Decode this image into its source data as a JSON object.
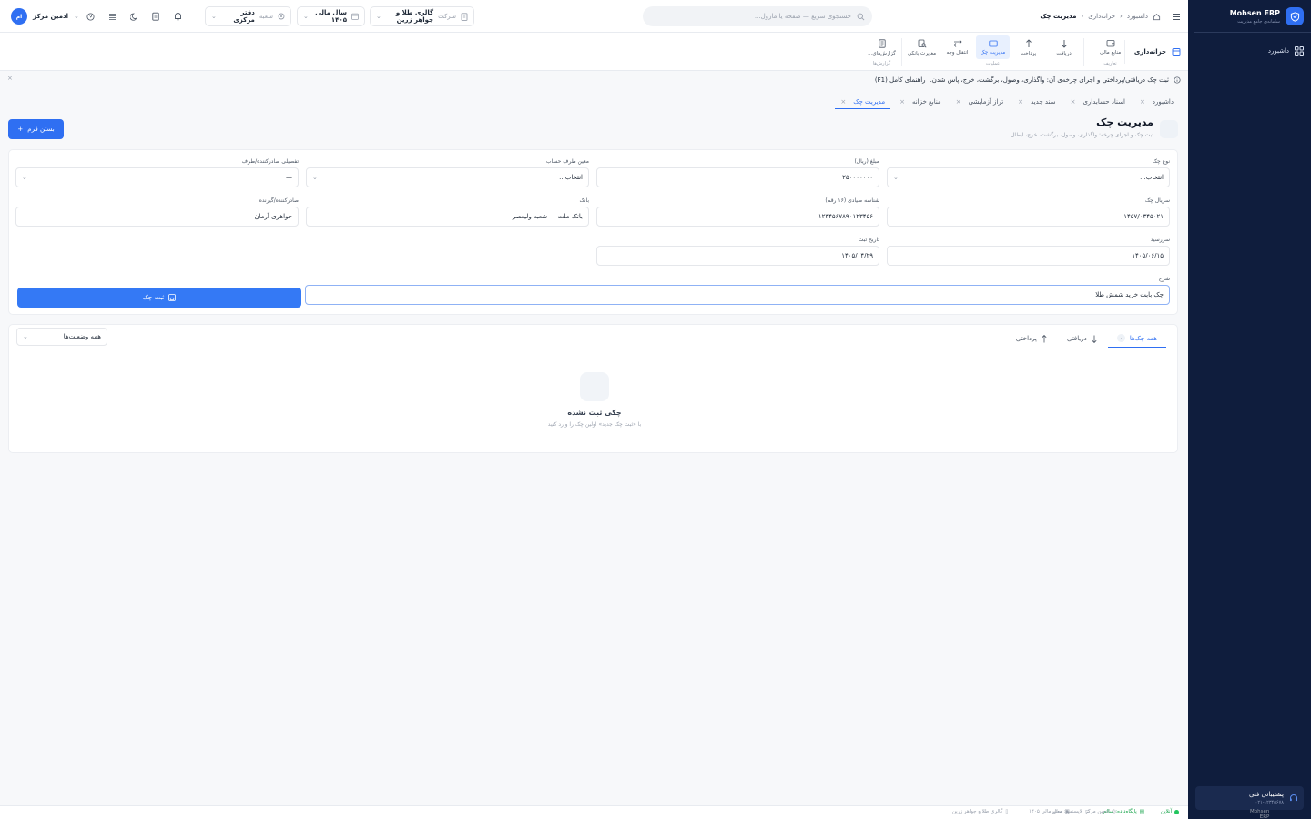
{
  "sidebar": {
    "brand_name": "Mohsen ERP",
    "brand_sub": "سامانه‌ی جامع مدیریت",
    "nav": [
      {
        "label": "داشبورد",
        "icon": "grid-icon"
      }
    ],
    "support_title": "پشتیبانی فنی",
    "support_phone": "۰۲۱-۱۲۳۴۵۶۷۸",
    "colors": {
      "bg": "#0f1d3d",
      "accent": "#2f6ff2"
    }
  },
  "header": {
    "breadcrumb": [
      "داشبورد",
      "خزانه‌داری",
      "مدیریت چک"
    ],
    "search_placeholder": "جستجوی سریع — صفحه یا ماژول...",
    "company_label": "شرکت",
    "company_value": "گالری طلا و جواهر زرین",
    "fiscal_year": "سال مالی ۱۴۰۵",
    "branch_label": "شعبه",
    "branch_value": "دفتر مرکزی",
    "user_name": "ادمین مرکز",
    "user_initials": "ام"
  },
  "ribbon": {
    "module": "خزانه‌داری",
    "groups": [
      {
        "label": "تعاریف",
        "items": [
          {
            "label": "منابع مالی",
            "icon": "wallet-icon"
          }
        ]
      },
      {
        "label": "عملیات",
        "items": [
          {
            "label": "دریافت",
            "icon": "arrow-down-icon"
          },
          {
            "label": "پرداخت",
            "icon": "arrow-up-icon"
          },
          {
            "label": "مدیریت چک",
            "icon": "check-icon",
            "active": true
          },
          {
            "label": "انتقال وجه",
            "icon": "transfer-icon"
          },
          {
            "label": "مغایرت بانکی",
            "icon": "bank-search-icon"
          }
        ]
      },
      {
        "label": "گزارش‌ها",
        "items": [
          {
            "label": "گزارش‌های...",
            "icon": "report-icon"
          }
        ]
      }
    ]
  },
  "info": {
    "text": "ثبت چک دریافتی/پرداختی و اجرای چرخه‌ی آن: واگذاری، وصول، برگشت، خرج، پاس شدن.",
    "guide": "راهنمای کامل (F1)"
  },
  "tabs": [
    "داشبورد",
    "اسناد حسابداری",
    "سند جدید",
    "تراز آزمایشی",
    "منابع خزانه",
    "مدیریت چک"
  ],
  "active_tab": 5,
  "page": {
    "title": "مدیریت چک",
    "subtitle": "ثبت چک و اجرای چرخه: واگذاری، وصول، برگشت، خرج، ابطال",
    "close_form": "بستن فرم"
  },
  "form": {
    "check_type": {
      "label": "نوع چک",
      "value": "انتخاب..."
    },
    "amount": {
      "label": "مبلغ (ریال)",
      "value": "۲۵۰۰۰۰۰۰۰"
    },
    "counter_account": {
      "label": "معین طرف حساب",
      "value": "انتخاب..."
    },
    "detail_account": {
      "label": "تفصیلی صادرکننده/طرف",
      "value": "—"
    },
    "serial": {
      "label": "سریال چک",
      "value": "۱۴۵۷/۰۳۴۵۰۲۱"
    },
    "sayad_id": {
      "label": "شناسه صیادی (۱۶ رقم)",
      "value": "۱۲۳۴۵۶۷۸۹۰۱۲۳۴۵۶"
    },
    "bank": {
      "label": "بانک",
      "value": "بانک ملت — شعبه ولیعصر"
    },
    "issuer": {
      "label": "صادرکننده/گیرنده",
      "value": "جواهری آرمان"
    },
    "due_date": {
      "label": "سررسید",
      "value": "۱۴۰۵/۰۶/۱۵"
    },
    "reg_date": {
      "label": "تاریخ ثبت",
      "value": "۱۴۰۵/۰۴/۲۹"
    },
    "description": {
      "label": "شرح",
      "value": "چک بابت خرید شمش طلا"
    },
    "submit": "ثبت چک"
  },
  "list": {
    "tabs": [
      {
        "label": "همه چک‌ها",
        "count": "۰",
        "active": true
      },
      {
        "label": "دریافتی"
      },
      {
        "label": "پرداختی"
      }
    ],
    "status_filter": "همه وضعیت‌ها",
    "empty_title": "چکی ثبت نشده",
    "empty_sub": "با «ثبت چک جدید» اولین چک را وارد کنید"
  },
  "statusbar": {
    "online": "آنلاین",
    "db": "پایگاه‌داده: سالم",
    "license": "لایسنس: معتبر",
    "company": "گالری طلا و جواهر زرین",
    "year": "سال مالی ۱۴۰۵",
    "user": "ادمین مرکز",
    "version": "Mohsen ERP نسخه ۱.۰"
  }
}
